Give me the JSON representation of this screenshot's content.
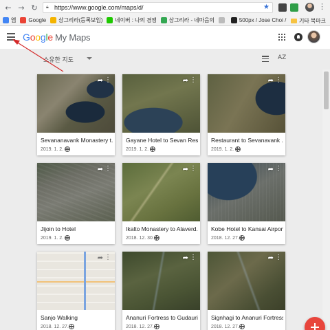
{
  "browser": {
    "back_icon": "back-arrow-icon",
    "url": "https://www.google.com/maps/d/",
    "bookmarks": [
      {
        "label": "앱",
        "color": "#4285f4"
      },
      {
        "label": "Google",
        "color": "#ea4335"
      },
      {
        "label": "상그리라(등록보입)",
        "color": "#f4b400"
      },
      {
        "label": "네이버 : 나의 경쟁",
        "color": "#1ec800"
      },
      {
        "label": "상그리라 - 네마음의",
        "color": "#34a853"
      },
      {
        "label": "",
        "color": "#888888"
      },
      {
        "label": "500px / Jose Choi /",
        "color": "#222222"
      },
      {
        "label": "",
        "color": "#f6c342"
      }
    ],
    "other_bookmarks": "기타 북마크"
  },
  "app": {
    "logo_google": [
      "G",
      "o",
      "o",
      "g",
      "l",
      "e"
    ],
    "product": "My Maps"
  },
  "toolbar": {
    "filter_label": "소유한 지도",
    "sort_label": "AZ"
  },
  "maps": [
    {
      "title": "Sevananavank Monastery t...",
      "date": "2019. 1. 2."
    },
    {
      "title": "Gayane Hotel to Sevan Rest...",
      "date": "2019. 1. 2."
    },
    {
      "title": "Restaurant to Sevanavank ...",
      "date": "2019. 1. 2."
    },
    {
      "title": "Jijoin to Hotel",
      "date": "2019. 1. 2."
    },
    {
      "title": "Ikalto Monastery to Alaverd...",
      "date": "2018. 12. 30."
    },
    {
      "title": "Kobe Hotel to Kansai Airport",
      "date": "2018. 12. 27."
    },
    {
      "title": "Sanjo Walking",
      "date": "2018. 12. 27."
    },
    {
      "title": "Ananuri Fortress to Gudauri",
      "date": "2018. 12. 27."
    },
    {
      "title": "Signhagi to Ananuri Fortress",
      "date": "2018. 12. 27."
    }
  ]
}
